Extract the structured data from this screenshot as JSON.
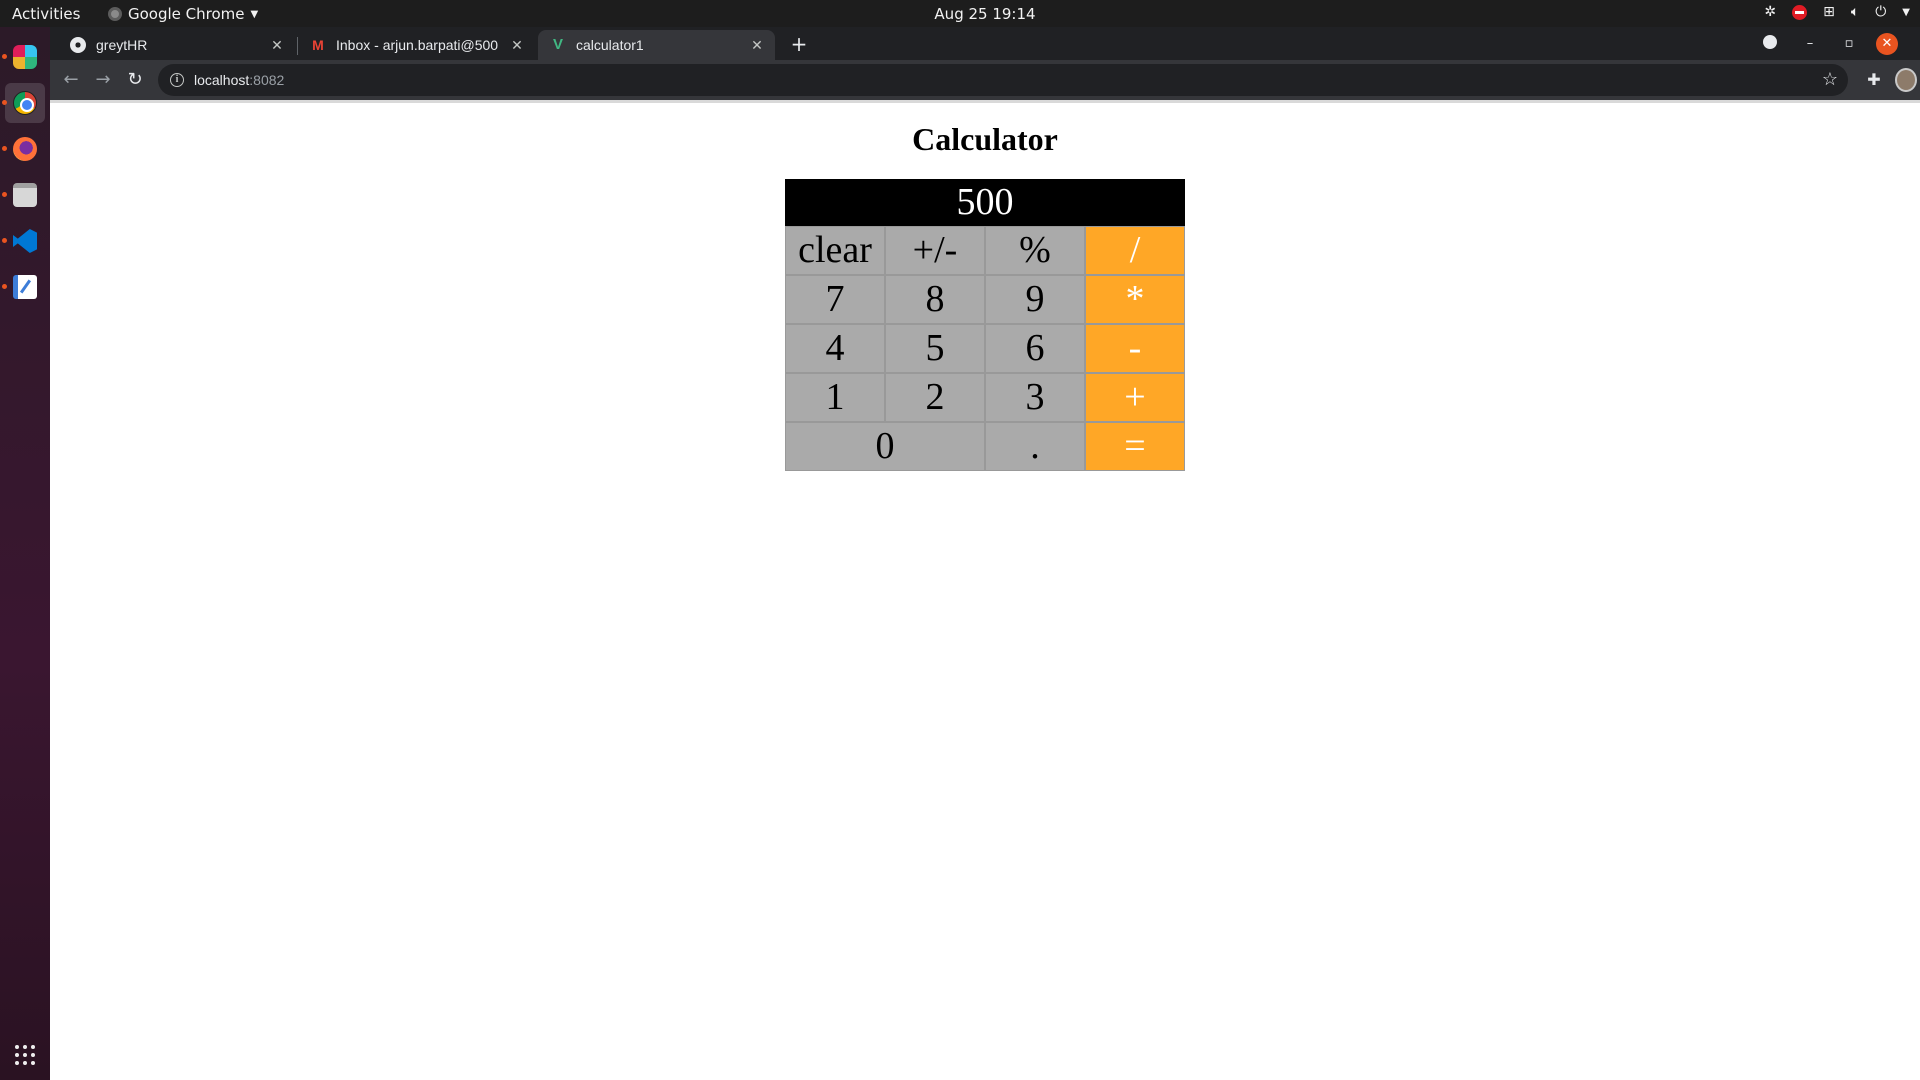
{
  "system": {
    "activities": "Activities",
    "app_name": "Google Chrome",
    "clock": "Aug 25  19:14"
  },
  "dock": {
    "apps": [
      "slack",
      "google-chrome",
      "firefox",
      "files",
      "vscode",
      "text-editor"
    ]
  },
  "browser": {
    "tabs": [
      {
        "title": "greytHR",
        "icon": "globe-icon",
        "active": false
      },
      {
        "title": "Inbox - arjun.barpati@500",
        "icon": "gmail-icon",
        "active": false
      },
      {
        "title": "calculator1",
        "icon": "vue-icon",
        "active": true
      }
    ],
    "address": {
      "host": "localhost",
      "port": ":8082"
    }
  },
  "page": {
    "title": "Calculator",
    "display": "500",
    "keys": [
      {
        "label": "clear",
        "type": "function"
      },
      {
        "label": "+/-",
        "type": "function"
      },
      {
        "label": "%",
        "type": "function"
      },
      {
        "label": "/",
        "type": "operator"
      },
      {
        "label": "7",
        "type": "digit"
      },
      {
        "label": "8",
        "type": "digit"
      },
      {
        "label": "9",
        "type": "digit"
      },
      {
        "label": "*",
        "type": "operator"
      },
      {
        "label": "4",
        "type": "digit"
      },
      {
        "label": "5",
        "type": "digit"
      },
      {
        "label": "6",
        "type": "digit"
      },
      {
        "label": "-",
        "type": "operator"
      },
      {
        "label": "1",
        "type": "digit"
      },
      {
        "label": "2",
        "type": "digit"
      },
      {
        "label": "3",
        "type": "digit"
      },
      {
        "label": "+",
        "type": "operator"
      },
      {
        "label": "0",
        "type": "digit"
      },
      {
        "label": ".",
        "type": "digit"
      },
      {
        "label": "=",
        "type": "operator"
      }
    ]
  },
  "colors": {
    "key_bg": "#aaaaaa",
    "operator_bg": "#ffa726",
    "display_bg": "#000000",
    "ubuntu_accent": "#e95420"
  }
}
